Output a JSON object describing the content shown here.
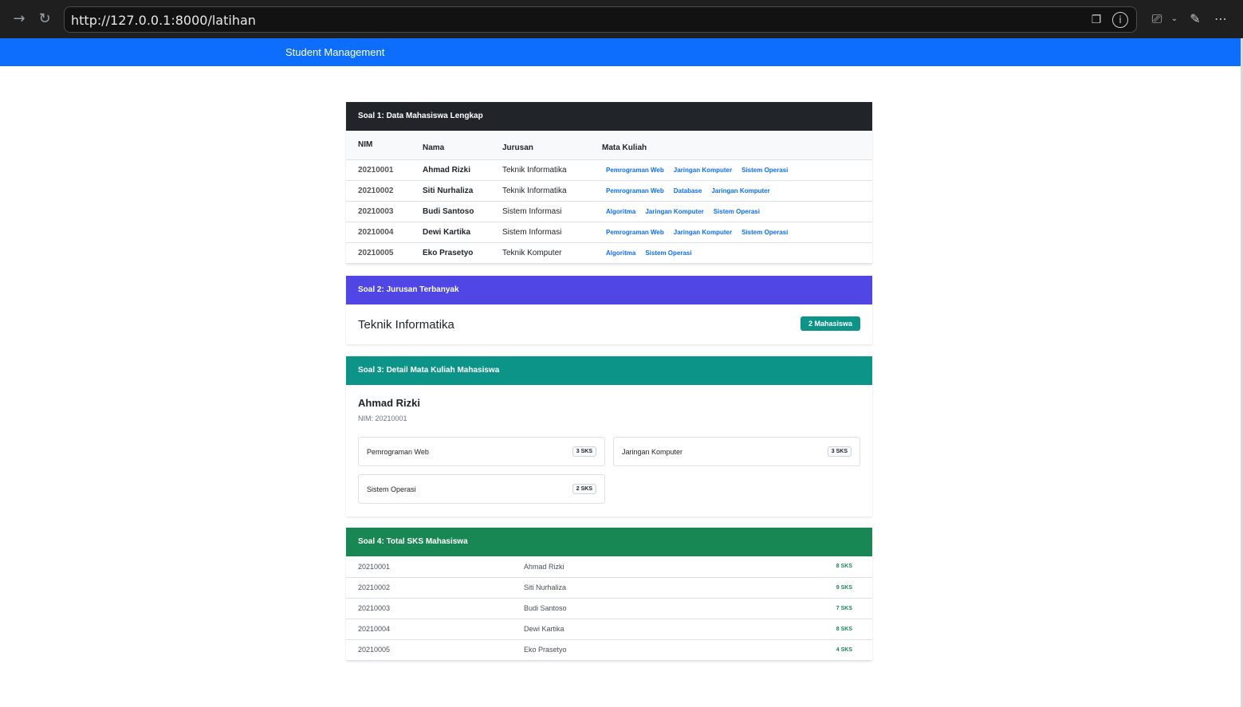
{
  "browser": {
    "url": "http://127.0.0.1:8000/latihan"
  },
  "navbar": {
    "brand": "Student Management"
  },
  "soal1": {
    "title": "Soal 1: Data Mahasiswa Lengkap",
    "headers": [
      "NIM",
      "Nama",
      "Jurusan",
      "Mata Kuliah"
    ],
    "rows": [
      {
        "nim": "20210001",
        "nama": "Ahmad Rizki",
        "jurusan": "Teknik Informatika",
        "mk": [
          "Pemrograman Web",
          "Jaringan Komputer",
          "Sistem Operasi"
        ]
      },
      {
        "nim": "20210002",
        "nama": "Siti Nurhaliza",
        "jurusan": "Teknik Informatika",
        "mk": [
          "Pemrograman Web",
          "Database",
          "Jaringan Komputer"
        ]
      },
      {
        "nim": "20210003",
        "nama": "Budi Santoso",
        "jurusan": "Sistem Informasi",
        "mk": [
          "Algoritma",
          "Jaringan Komputer",
          "Sistem Operasi"
        ]
      },
      {
        "nim": "20210004",
        "nama": "Dewi Kartika",
        "jurusan": "Sistem Informasi",
        "mk": [
          "Pemrograman Web",
          "Jaringan Komputer",
          "Sistem Operasi"
        ]
      },
      {
        "nim": "20210005",
        "nama": "Eko Prasetyo",
        "jurusan": "Teknik Komputer",
        "mk": [
          "Algoritma",
          "Sistem Operasi"
        ]
      }
    ]
  },
  "soal2": {
    "title": "Soal 2: Jurusan Terbanyak",
    "jurusan": "Teknik Informatika",
    "badge": "2 Mahasiswa"
  },
  "soal3": {
    "title": "Soal 3: Detail Mata Kuliah Mahasiswa",
    "name": "Ahmad Rizki",
    "nim": "NIM: 20210001",
    "courses": [
      {
        "name": "Pemrograman Web",
        "sks": "3 SKS"
      },
      {
        "name": "Jaringan Komputer",
        "sks": "3 SKS"
      },
      {
        "name": "Sistem Operasi",
        "sks": "2 SKS"
      }
    ]
  },
  "soal4": {
    "title": "Soal 4: Total SKS Mahasiswa",
    "rows": [
      {
        "nim": "20210001",
        "nama": "Ahmad Rizki",
        "sks": "8 SKS"
      },
      {
        "nim": "20210002",
        "nama": "Siti Nurhaliza",
        "sks": "9 SKS"
      },
      {
        "nim": "20210003",
        "nama": "Budi Santoso",
        "sks": "7 SKS"
      },
      {
        "nim": "20210004",
        "nama": "Dewi Kartika",
        "sks": "8 SKS"
      },
      {
        "nim": "20210005",
        "nama": "Eko Prasetyo",
        "sks": "4 SKS"
      }
    ]
  }
}
